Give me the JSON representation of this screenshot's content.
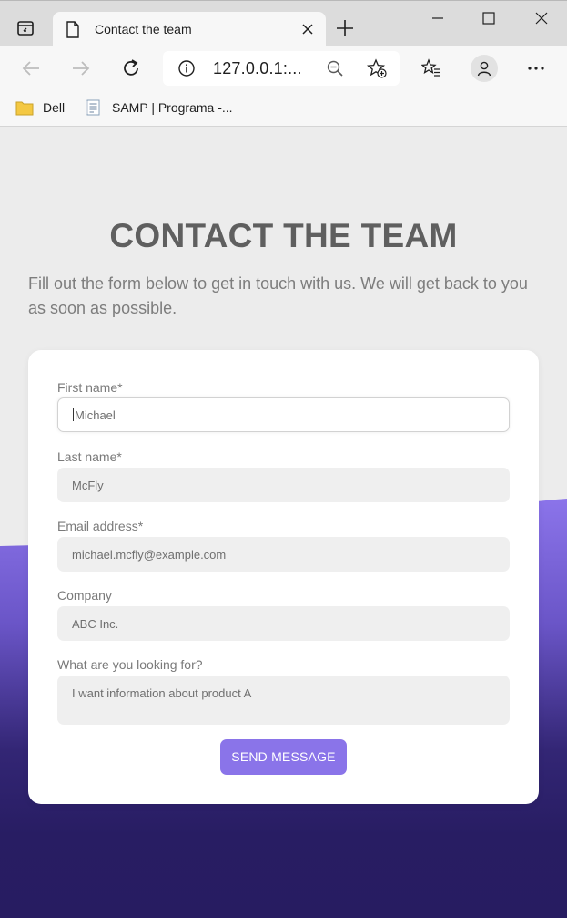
{
  "browser": {
    "tab_title": "Contact the team",
    "url": "127.0.0.1:...",
    "bookmarks": [
      {
        "label": "Dell",
        "icon": "folder-icon"
      },
      {
        "label": "SAMP | Programa -...",
        "icon": "document-icon"
      }
    ]
  },
  "page": {
    "heading": "CONTACT THE TEAM",
    "intro": "Fill out the form below to get in touch with us. We will get back to you as soon as possible."
  },
  "form": {
    "first_name": {
      "label": "First name*",
      "value": "Michael"
    },
    "last_name": {
      "label": "Last name*",
      "value": "McFly"
    },
    "email": {
      "label": "Email address*",
      "value": "michael.mcfly@example.com"
    },
    "company": {
      "label": "Company",
      "value": "ABC Inc."
    },
    "looking_for": {
      "label": "What are you looking for?",
      "value": "I want information about product A"
    },
    "submit_label": "SEND MESSAGE"
  },
  "colors": {
    "accent": "#8a74e9",
    "wave_light": "#8a74e9",
    "wave_dark": "#2a1f66",
    "heading": "#5f5f5f",
    "page_bg": "#ececec"
  }
}
